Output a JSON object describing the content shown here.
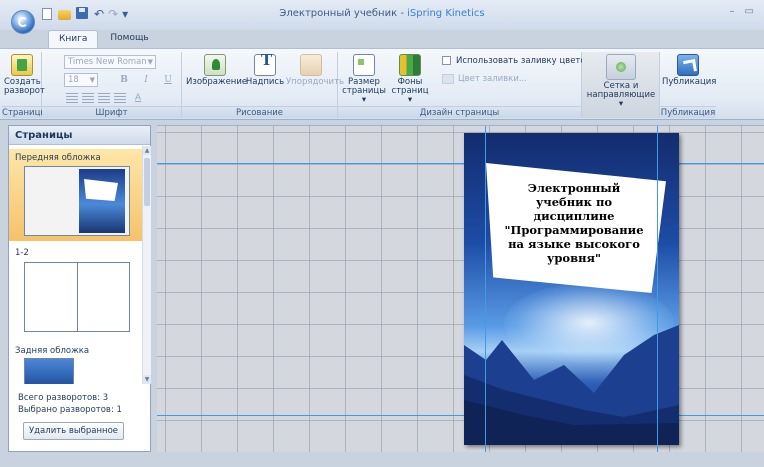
{
  "window": {
    "title_prefix": "Электронный учебник - ",
    "title_brand": "iSpring Kinetics",
    "minimize": "–",
    "restore": "▭"
  },
  "qat": {
    "undo": "↶",
    "redo": "↷",
    "more": "▾"
  },
  "tabs": [
    {
      "label": "Книга",
      "active": true
    },
    {
      "label": "Помощь",
      "active": false
    }
  ],
  "ribbon": {
    "groups": {
      "pages": {
        "label": "Страницы",
        "create_line1": "Создать",
        "create_line2": "разворот"
      },
      "font": {
        "label": "Шрифт",
        "font_name": "Times New Roman",
        "font_size": "18",
        "bold": "B",
        "italic": "I",
        "underline": "U",
        "color": "A"
      },
      "drawing": {
        "label": "Рисование",
        "image": "Изображение",
        "text": "Надпись",
        "arrange": "Упорядочить"
      },
      "design": {
        "label": "Дизайн страницы",
        "size_line1": "Размер",
        "size_line2": "страницы ▾",
        "bg_line1": "Фоны",
        "bg_line2": "страниц ▾",
        "use_fill": "Использовать заливку цветом",
        "fill_color": "Цвет заливки..."
      },
      "grid": {
        "label_line1": "Сетка и",
        "label_line2": "направляющие ▾"
      },
      "publish": {
        "label": "Публикация",
        "button": "Публикация"
      }
    }
  },
  "pages_pane": {
    "header": "Страницы",
    "thumbnails": [
      {
        "label": "Передняя обложка",
        "selected": true
      },
      {
        "label": "1-2",
        "selected": false
      },
      {
        "label": "Задняя обложка",
        "selected": false
      }
    ],
    "total_spreads": "Всего разворотов: 3",
    "selected_spreads": "Выбрано разворотов: 1",
    "delete_button": "Удалить выбранное"
  },
  "canvas": {
    "cover_title": "Электронный учебник по дисциплине \"Программирование на языке высокого уровня\""
  },
  "colors": {
    "accent": "#3a7fd2",
    "guide": "#3d9be8",
    "selection": "#f6c26a"
  }
}
